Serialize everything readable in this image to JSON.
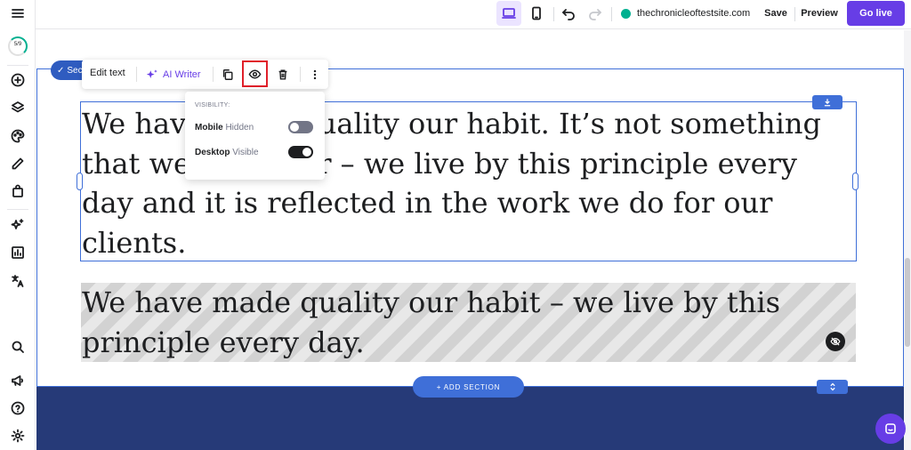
{
  "topbar": {
    "site_url": "thechronicleoftestsite.com",
    "save_label": "Save",
    "preview_label": "Preview",
    "go_live_label": "Go live",
    "status_dot_color": "#00b090",
    "accent_color": "#673de6"
  },
  "sidebar": {
    "progress_label": "5/9",
    "icons": [
      "menu-icon",
      "progress-ring",
      "add-icon",
      "layers-icon",
      "palette-icon",
      "pen-icon",
      "store-icon",
      "ai-sparkle-icon",
      "analytics-icon",
      "translate-icon",
      "search-icon",
      "megaphone-icon",
      "help-icon",
      "settings-icon"
    ]
  },
  "toolbar": {
    "edit_text_label": "Edit text",
    "ai_writer_label": "AI Writer"
  },
  "section_badge": {
    "label": "Sec"
  },
  "visibility_popup": {
    "heading": "VISIBILITY:",
    "rows": [
      {
        "device": "Mobile",
        "state": "Hidden",
        "on": false
      },
      {
        "device": "Desktop",
        "state": "Visible",
        "on": true
      }
    ]
  },
  "content": {
    "paragraph1_lines": [
      "We have made quality our habit. It’s not something",
      "that we strive for – we live by this principle every",
      "day and it is reflected in the work we do for our",
      "clients."
    ],
    "paragraph2_lines": [
      "We have made quality our habit – we live by this",
      "principle every day."
    ]
  },
  "add_section": {
    "label": "+ ADD SECTION"
  },
  "footer_color": "#263a78"
}
